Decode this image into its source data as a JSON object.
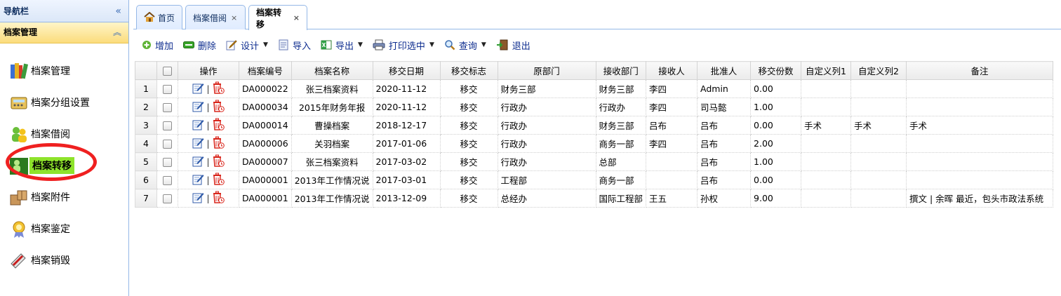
{
  "sidebar": {
    "nav_title": "导航栏",
    "nav_collapse": "«",
    "panel_title": "档案管理",
    "panel_collapse": "︽",
    "items": [
      {
        "label": "档案管理"
      },
      {
        "label": "档案分组设置"
      },
      {
        "label": "档案借阅"
      },
      {
        "label": "档案转移"
      },
      {
        "label": "档案附件"
      },
      {
        "label": "档案鉴定"
      },
      {
        "label": "档案销毁"
      }
    ]
  },
  "tabs": [
    {
      "label": "首页"
    },
    {
      "label": "档案借阅",
      "close": "×"
    },
    {
      "label": "档案转移",
      "close": "×"
    }
  ],
  "toolbar": {
    "add": "增加",
    "delete": "删除",
    "design": "设计",
    "import": "导入",
    "export": "导出",
    "print": "打印选中",
    "query": "查询",
    "exit": "退出",
    "caret": "▼"
  },
  "grid": {
    "headers": [
      "操作",
      "档案编号",
      "档案名称",
      "移交日期",
      "移交标志",
      "原部门",
      "接收部门",
      "接收人",
      "批准人",
      "移交份数",
      "自定义列1",
      "自定义列2",
      "备注"
    ],
    "op_separator": "|",
    "rows": [
      {
        "n": "1",
        "id": "DA000022",
        "name": "张三档案资料",
        "date": "2020-11-12",
        "flag": "移交",
        "from": "财务三部",
        "to": "财务三部",
        "recv": "李四",
        "appr": "Admin",
        "count": "0.00",
        "c1": "",
        "c2": "",
        "note": ""
      },
      {
        "n": "2",
        "id": "DA000034",
        "name": "2015年财务年报",
        "date": "2020-11-12",
        "flag": "移交",
        "from": "行政办",
        "to": "行政办",
        "recv": "李四",
        "appr": "司马懿",
        "count": "1.00",
        "c1": "",
        "c2": "",
        "note": ""
      },
      {
        "n": "3",
        "id": "DA000014",
        "name": "曹操档案",
        "date": "2018-12-17",
        "flag": "移交",
        "from": "行政办",
        "to": "财务三部",
        "recv": "吕布",
        "appr": "吕布",
        "count": "0.00",
        "c1": "手术",
        "c2": "手术",
        "note": "手术"
      },
      {
        "n": "4",
        "id": "DA000006",
        "name": "关羽档案",
        "date": "2017-01-06",
        "flag": "移交",
        "from": "行政办",
        "to": "商务一部",
        "recv": "李四",
        "appr": "吕布",
        "count": "2.00",
        "c1": "",
        "c2": "",
        "note": ""
      },
      {
        "n": "5",
        "id": "DA000007",
        "name": "张三档案资料",
        "date": "2017-03-02",
        "flag": "移交",
        "from": "行政办",
        "to": "总部",
        "recv": "",
        "appr": "吕布",
        "count": "1.00",
        "c1": "",
        "c2": "",
        "note": ""
      },
      {
        "n": "6",
        "id": "DA000001",
        "name": "2013年工作情况说",
        "date": "2017-03-01",
        "flag": "移交",
        "from": "工程部",
        "to": "商务一部",
        "recv": "",
        "appr": "吕布",
        "count": "0.00",
        "c1": "",
        "c2": "",
        "note": ""
      },
      {
        "n": "7",
        "id": "DA000001",
        "name": "2013年工作情况说",
        "date": "2013-12-09",
        "flag": "移交",
        "from": "总经办",
        "to": "国际工程部",
        "recv": "王五",
        "appr": "孙权",
        "count": "9.00",
        "c1": "",
        "c2": "",
        "note": "撰文 | 余晖 最近，包头市政法系统"
      }
    ]
  },
  "colors": {
    "accent_border": "#95b8e7",
    "active_item": "#8ee32b",
    "highlight_ring": "#ef2020",
    "delete_icon": "#d9261c"
  }
}
